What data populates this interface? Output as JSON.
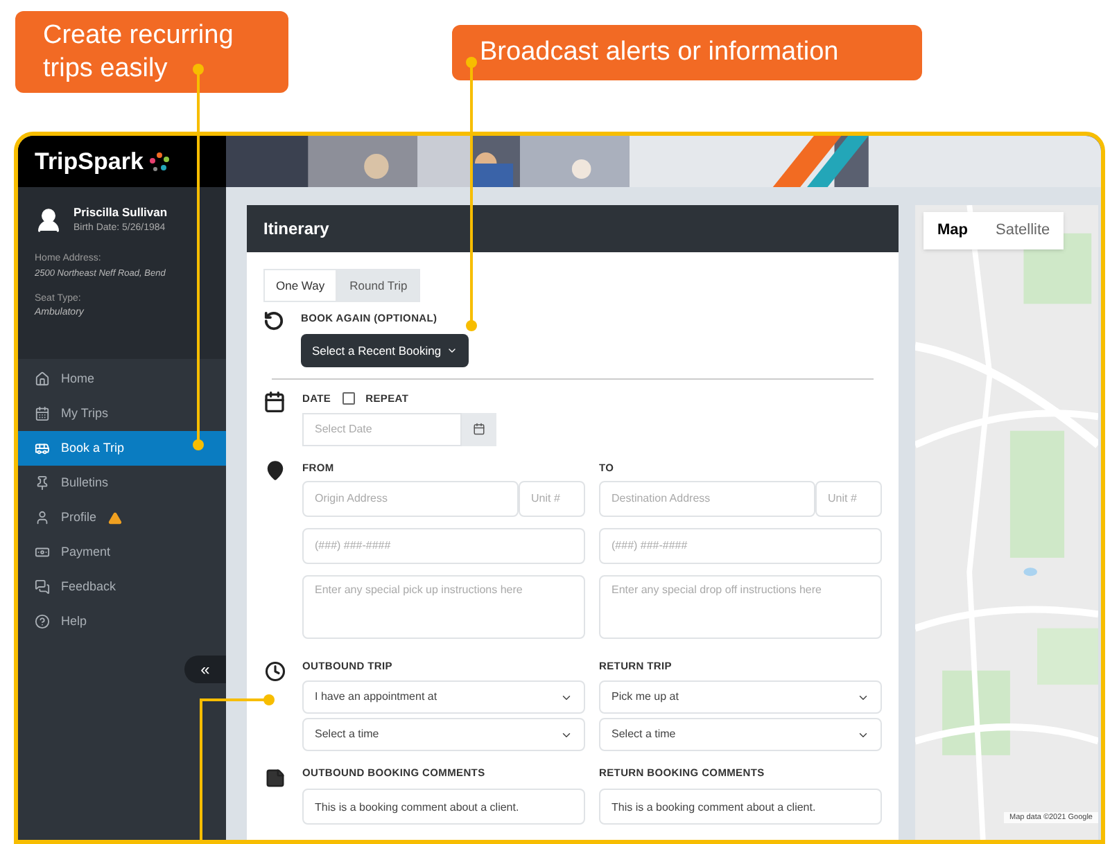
{
  "callouts": [
    {
      "text": "Create recurring trips easily"
    },
    {
      "text": "Broadcast alerts or information"
    }
  ],
  "logo": "TripSpark",
  "user": {
    "name": "Priscilla Sullivan",
    "birth": "Birth Date: 5/26/1984",
    "address_label": "Home Address:",
    "address": "2500 Northeast Neff Road, Bend",
    "seat_label": "Seat Type:",
    "seat": "Ambulatory"
  },
  "nav": [
    {
      "label": "Home",
      "selected": false,
      "warning": false
    },
    {
      "label": "My Trips",
      "selected": false,
      "warning": false
    },
    {
      "label": "Book a Trip",
      "selected": true,
      "warning": false
    },
    {
      "label": "Bulletins",
      "selected": false,
      "warning": false
    },
    {
      "label": "Profile",
      "selected": false,
      "warning": true
    },
    {
      "label": "Payment",
      "selected": false,
      "warning": false
    },
    {
      "label": "Feedback",
      "selected": false,
      "warning": false
    },
    {
      "label": "Help",
      "selected": false,
      "warning": false
    }
  ],
  "collapse": "«",
  "itinerary": {
    "title": "Itinerary",
    "tabs": [
      {
        "label": "One Way",
        "selected": true
      },
      {
        "label": "Round Trip",
        "selected": false
      }
    ],
    "book_again": "BOOK AGAIN (OPTIONAL)",
    "recent_button": "Select a Recent Booking",
    "date_label": "DATE",
    "repeat": {
      "label": "REPEAT",
      "checked": false
    },
    "date": {
      "placeholder": "Select Date"
    },
    "columns": [
      {
        "label": "FROM",
        "address": {
          "placeholder": "Origin Address"
        },
        "unit": {
          "placeholder": "Unit #"
        },
        "phone": {
          "placeholder": "(###) ###-####"
        },
        "notes": {
          "placeholder": "Enter any special pick up instructions here"
        },
        "trip_label": "OUTBOUND TRIP",
        "trip_type": "I have an appointment at",
        "time": "Select a time",
        "comments_label": "OUTBOUND BOOKING COMMENTS",
        "comment": "This is a booking comment about a client."
      },
      {
        "label": "TO",
        "address": {
          "placeholder": "Destination Address"
        },
        "unit": {
          "placeholder": "Unit #"
        },
        "phone": {
          "placeholder": "(###) ###-####"
        },
        "notes": {
          "placeholder": "Enter any special drop off instructions here"
        },
        "trip_label": "RETURN TRIP",
        "trip_type": "Pick me up at",
        "time": "Select a time",
        "comments_label": "RETURN BOOKING COMMENTS",
        "comment": "This is a booking comment about a client."
      }
    ]
  },
  "map": {
    "views": [
      {
        "label": "Map",
        "selected": true
      },
      {
        "label": "Satellite",
        "selected": false
      }
    ],
    "attribution": "Map data ©2021 Google"
  }
}
